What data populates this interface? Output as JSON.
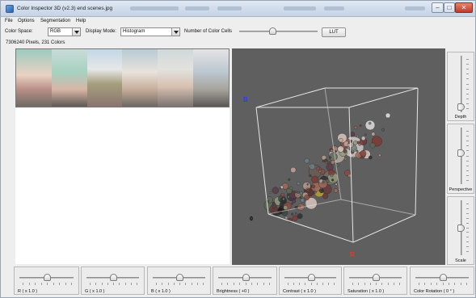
{
  "window": {
    "title": "Color Inspector 3D (v2.3)   end scenes.jpg",
    "minimize": "–",
    "maximize": "□",
    "close": "✕"
  },
  "menu": [
    "File",
    "Options",
    "Segmentation",
    "Help"
  ],
  "toolbar": {
    "color_space_label": "Color Space:",
    "color_space_value": "RGB",
    "display_mode_label": "Display Mode:",
    "display_mode_value": "Histogram",
    "color_cells_label": "Number of Color Cells",
    "color_cells_level": 0.42,
    "lut_button": "LUT"
  },
  "info": {
    "pixels": "7306240 Pixels, 231 Colors"
  },
  "viewport": {
    "axis_b": "B",
    "axis_r": "R",
    "origin": "0",
    "colors": {
      "background": "#5f5f5f",
      "axis_b": "#2a3cff",
      "axis_r": "#ff2a2a"
    }
  },
  "side_sliders": [
    {
      "label": "Depth",
      "level": 0.96
    },
    {
      "label": "Perspective",
      "level": 0.45
    },
    {
      "label": "Scale",
      "level": 0.5
    }
  ],
  "bottom_sliders": [
    {
      "label": "R ( x 1.0 )",
      "level": 0.5
    },
    {
      "label": "G ( x 1.0 )",
      "level": 0.5
    },
    {
      "label": "B ( x 1.0 )",
      "level": 0.5
    },
    {
      "label": "Brightness ( +0 )",
      "level": 0.5
    },
    {
      "label": "Contrast ( x 1.0 )",
      "level": 0.5
    },
    {
      "label": "Saturation ( x 1.0 )",
      "level": 0.5
    },
    {
      "label": "Color Rotation ( 0 ° )",
      "level": 0.5
    }
  ]
}
